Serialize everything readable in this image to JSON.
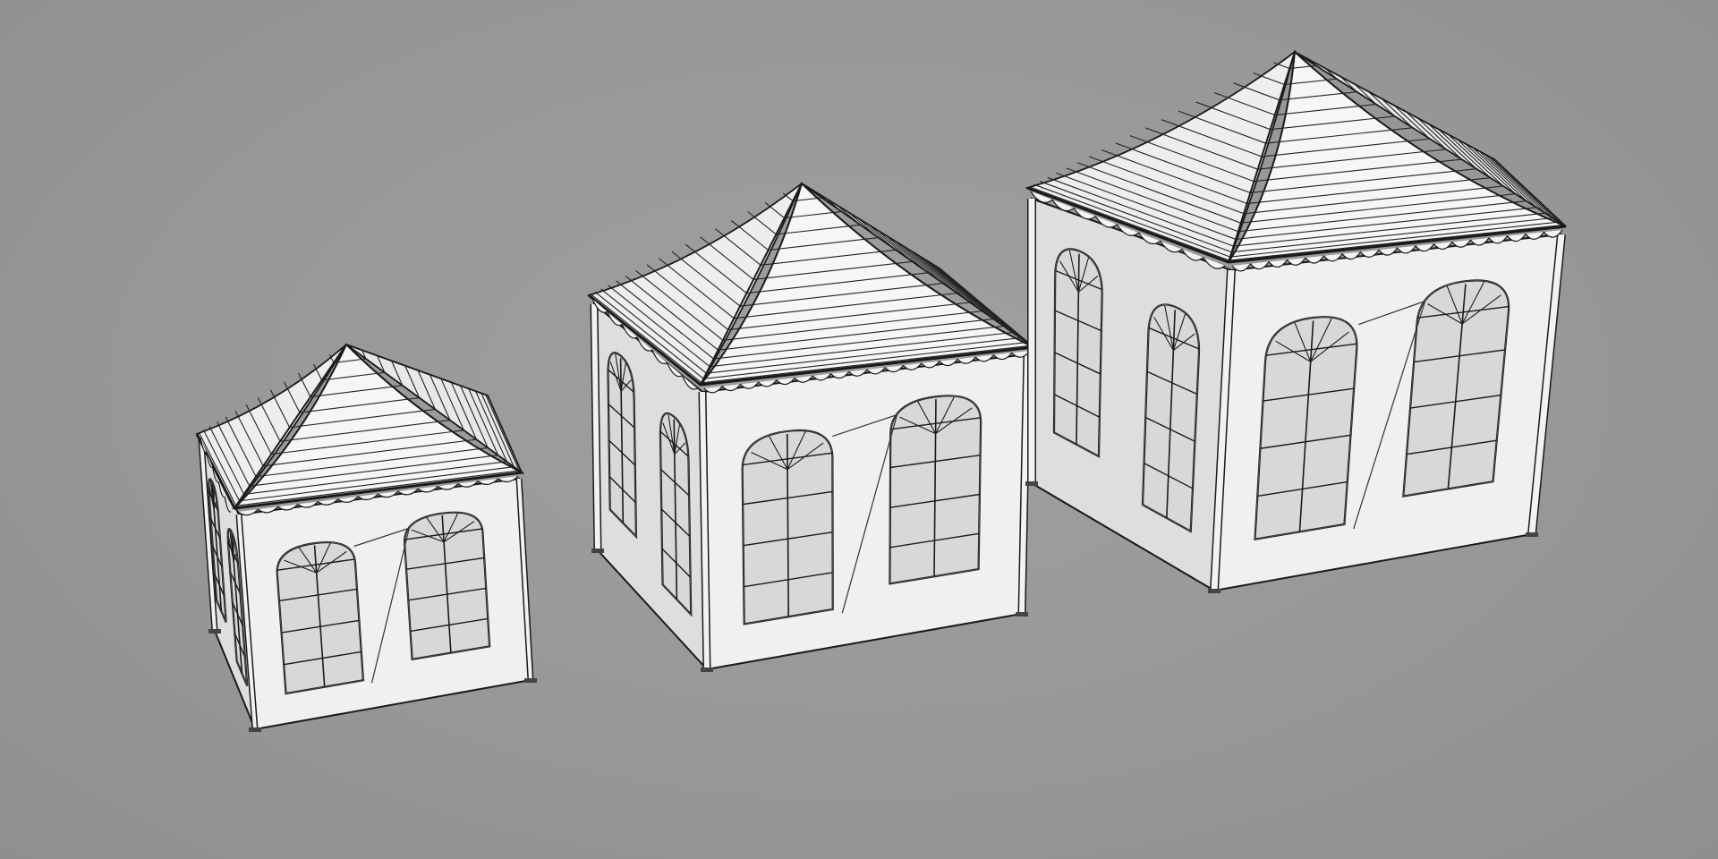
{
  "scene": {
    "background_color": "#989898",
    "outline_color": "#1a1a1a",
    "fabric_light": "#f0f0f0",
    "fabric_shade": "#dedede",
    "window_glass": "#d8d8d8",
    "objects": [
      {
        "name": "pagoda-tent-small",
        "windows_front": 2,
        "windows_side": 2
      },
      {
        "name": "pagoda-tent-medium",
        "windows_front": 2,
        "windows_side": 2
      },
      {
        "name": "pagoda-tent-large",
        "windows_front": 2,
        "windows_side": 2
      }
    ]
  }
}
